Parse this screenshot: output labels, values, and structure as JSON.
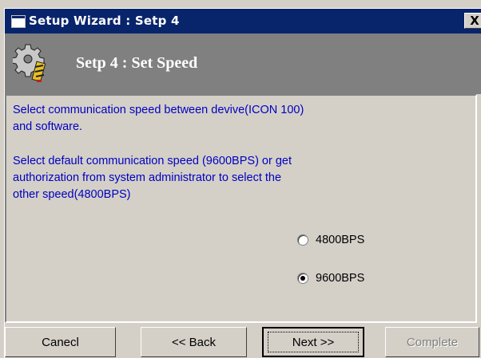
{
  "window": {
    "title": "Setup Wizard : Setp 4",
    "close_label": "X"
  },
  "banner": {
    "title": "Setp 4 : Set Speed",
    "icon": "gear-wrench-icon"
  },
  "content": {
    "paragraph1": "Select communication speed between devive(ICON 100)\nand software.",
    "paragraph2": "Select default communication speed (9600BPS) or get\nauthorization from system administrator to select  the\nother speed(4800BPS)"
  },
  "speed_options": [
    {
      "label": "4800BPS",
      "selected": false
    },
    {
      "label": "9600BPS",
      "selected": true
    }
  ],
  "buttons": {
    "cancel": "Canecl",
    "back": "<< Back",
    "next": "Next >>",
    "complete": "Complete"
  },
  "colors": {
    "title_bar": "#08246b",
    "banner": "#808080",
    "body_text": "#0000c0",
    "window_face": "#d4d0c8"
  }
}
